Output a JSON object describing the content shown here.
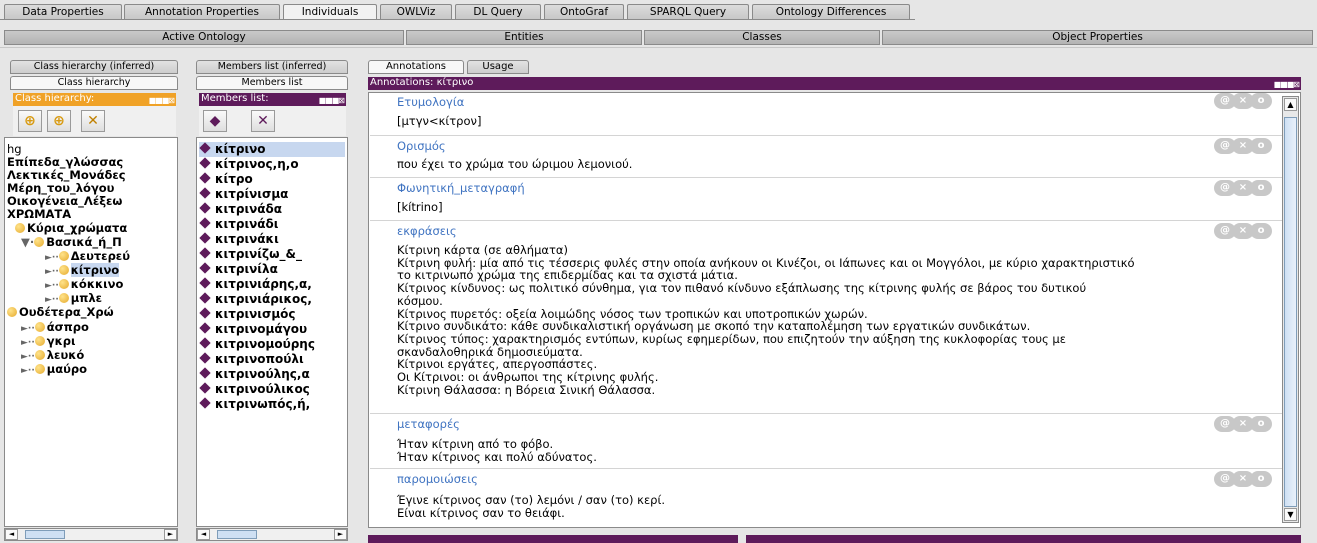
{
  "top_tabs": [
    "Data Properties",
    "Annotation Properties",
    "Individuals",
    "OWLViz",
    "DL Query",
    "OntoGraf",
    "SPARQL Query",
    "Ontology Differences"
  ],
  "active_top_tab": "Individuals",
  "sub_tabs": [
    "Active Ontology",
    "Entities",
    "Classes",
    "Object Properties"
  ],
  "class_panel": {
    "tab_inferred": "Class hierarchy (inferred)",
    "tab_asserted": "Class hierarchy",
    "title": "Class hierarchy:",
    "items": [
      "hg",
      "Επίπεδα_γλώσσας",
      "Λεκτικές_Μονάδες",
      "Μέρη_του_λόγου",
      "Οικογένεια_Λέξεω",
      "ΧΡΩΜΑΤΑ",
      "Κύρια_χρώματα",
      "Βασικά_ή_Π",
      "Δευτερεύ",
      "κίτρινο",
      "κόκκινο",
      "μπλε",
      "Ουδέτερα_Χρώ",
      "άσπρο",
      "γκρι",
      "λευκό",
      "μαύρο"
    ]
  },
  "members_panel": {
    "tab_inferred": "Members list (inferred)",
    "tab_asserted": "Members list",
    "title": "Members list:",
    "items": [
      "κίτρινο",
      "κίτρινος,η,ο",
      "κίτρο",
      "κιτρίνισμα",
      "κιτρινάδα",
      "κιτρινάδι",
      "κιτρινάκι",
      "κιτρινίζω_&_",
      "κιτρινίλα",
      "κιτρινιάρης,α,",
      "κιτρινιάρικος,",
      "κιτρινισμός",
      "κιτρινομάγου",
      "κιτρινομούρης",
      "κιτρινοπούλι",
      "κιτρινούλης,α",
      "κιτρινούλικος",
      "κιτρινωπός,ή,"
    ]
  },
  "annotations_panel": {
    "tab_annotations": "Annotations",
    "tab_usage": "Usage",
    "title": "Annotations: κίτρινο",
    "icon_labels": [
      "@",
      "×",
      "o"
    ],
    "entries": [
      {
        "label": "Ετυμολογία",
        "value": "[μτγν<κίτρον]"
      },
      {
        "label": "Ορισμός",
        "value": "που έχει το χρώμα του ώριμου λεμονιού."
      },
      {
        "label": "Φωνητική_μεταγραφή",
        "value": "[kítrino]"
      },
      {
        "label": "εκφράσεις",
        "value": "Κίτρινη κάρτα (σε αθλήματα)\nΚίτρινη φυλή: μία από τις τέσσερις φυλές στην οποία ανήκουν οι Κινέζοι, οι Ιάπωνες και οι Μογγόλοι, με κύριο χαρακτηριστικό\nτο κιτρινωπό χρώμα της επιδερμίδας και τα σχιστά μάτια.\nΚίτρινος κίνδυνος: ως πολιτικό σύνθημα, για τον πιθανό κίνδυνο εξάπλωσης της κίτρινης φυλής σε βάρος του δυτικού\nκόσμου.\nΚίτρινος πυρετός: οξεία λοιμώδης νόσος των τροπικών και υποτροπικών χωρών.\nΚίτρινο συνδικάτο: κάθε συνδικαλιστική οργάνωση με σκοπό την καταπολέμηση των εργατικών συνδικάτων.\nΚίτρινος τύπος: χαρακτηρισμός εντύπων, κυρίως εφημερίδων, που επιζητούν την αύξηση της κυκλοφορίας τους με\nσκανδαλοθηρικά δημοσιεύματα.\nΚίτρινοι εργάτες, απεργοσπάστες.\nΟι Κίτρινοι: οι άνθρωποι της κίτρινης φυλής.\nΚίτρινη Θάλασσα: η Βόρεια Σινική Θάλασσα."
      },
      {
        "label": "μεταφορές",
        "value": "Ήταν κίτρινη από το φόβο.\nΉταν κίτρινος και πολύ αδύνατος."
      },
      {
        "label": "παρομοιώσεις",
        "value": "Έγινε κίτρινος σαν (το) λεμόνι / σαν (το) κερί.\nΕίναι κίτρινος σαν το θειάφι."
      }
    ]
  },
  "colors": {
    "orange": "#f0a227",
    "purple": "#5e1b5b",
    "label_blue": "#3f73c1"
  }
}
